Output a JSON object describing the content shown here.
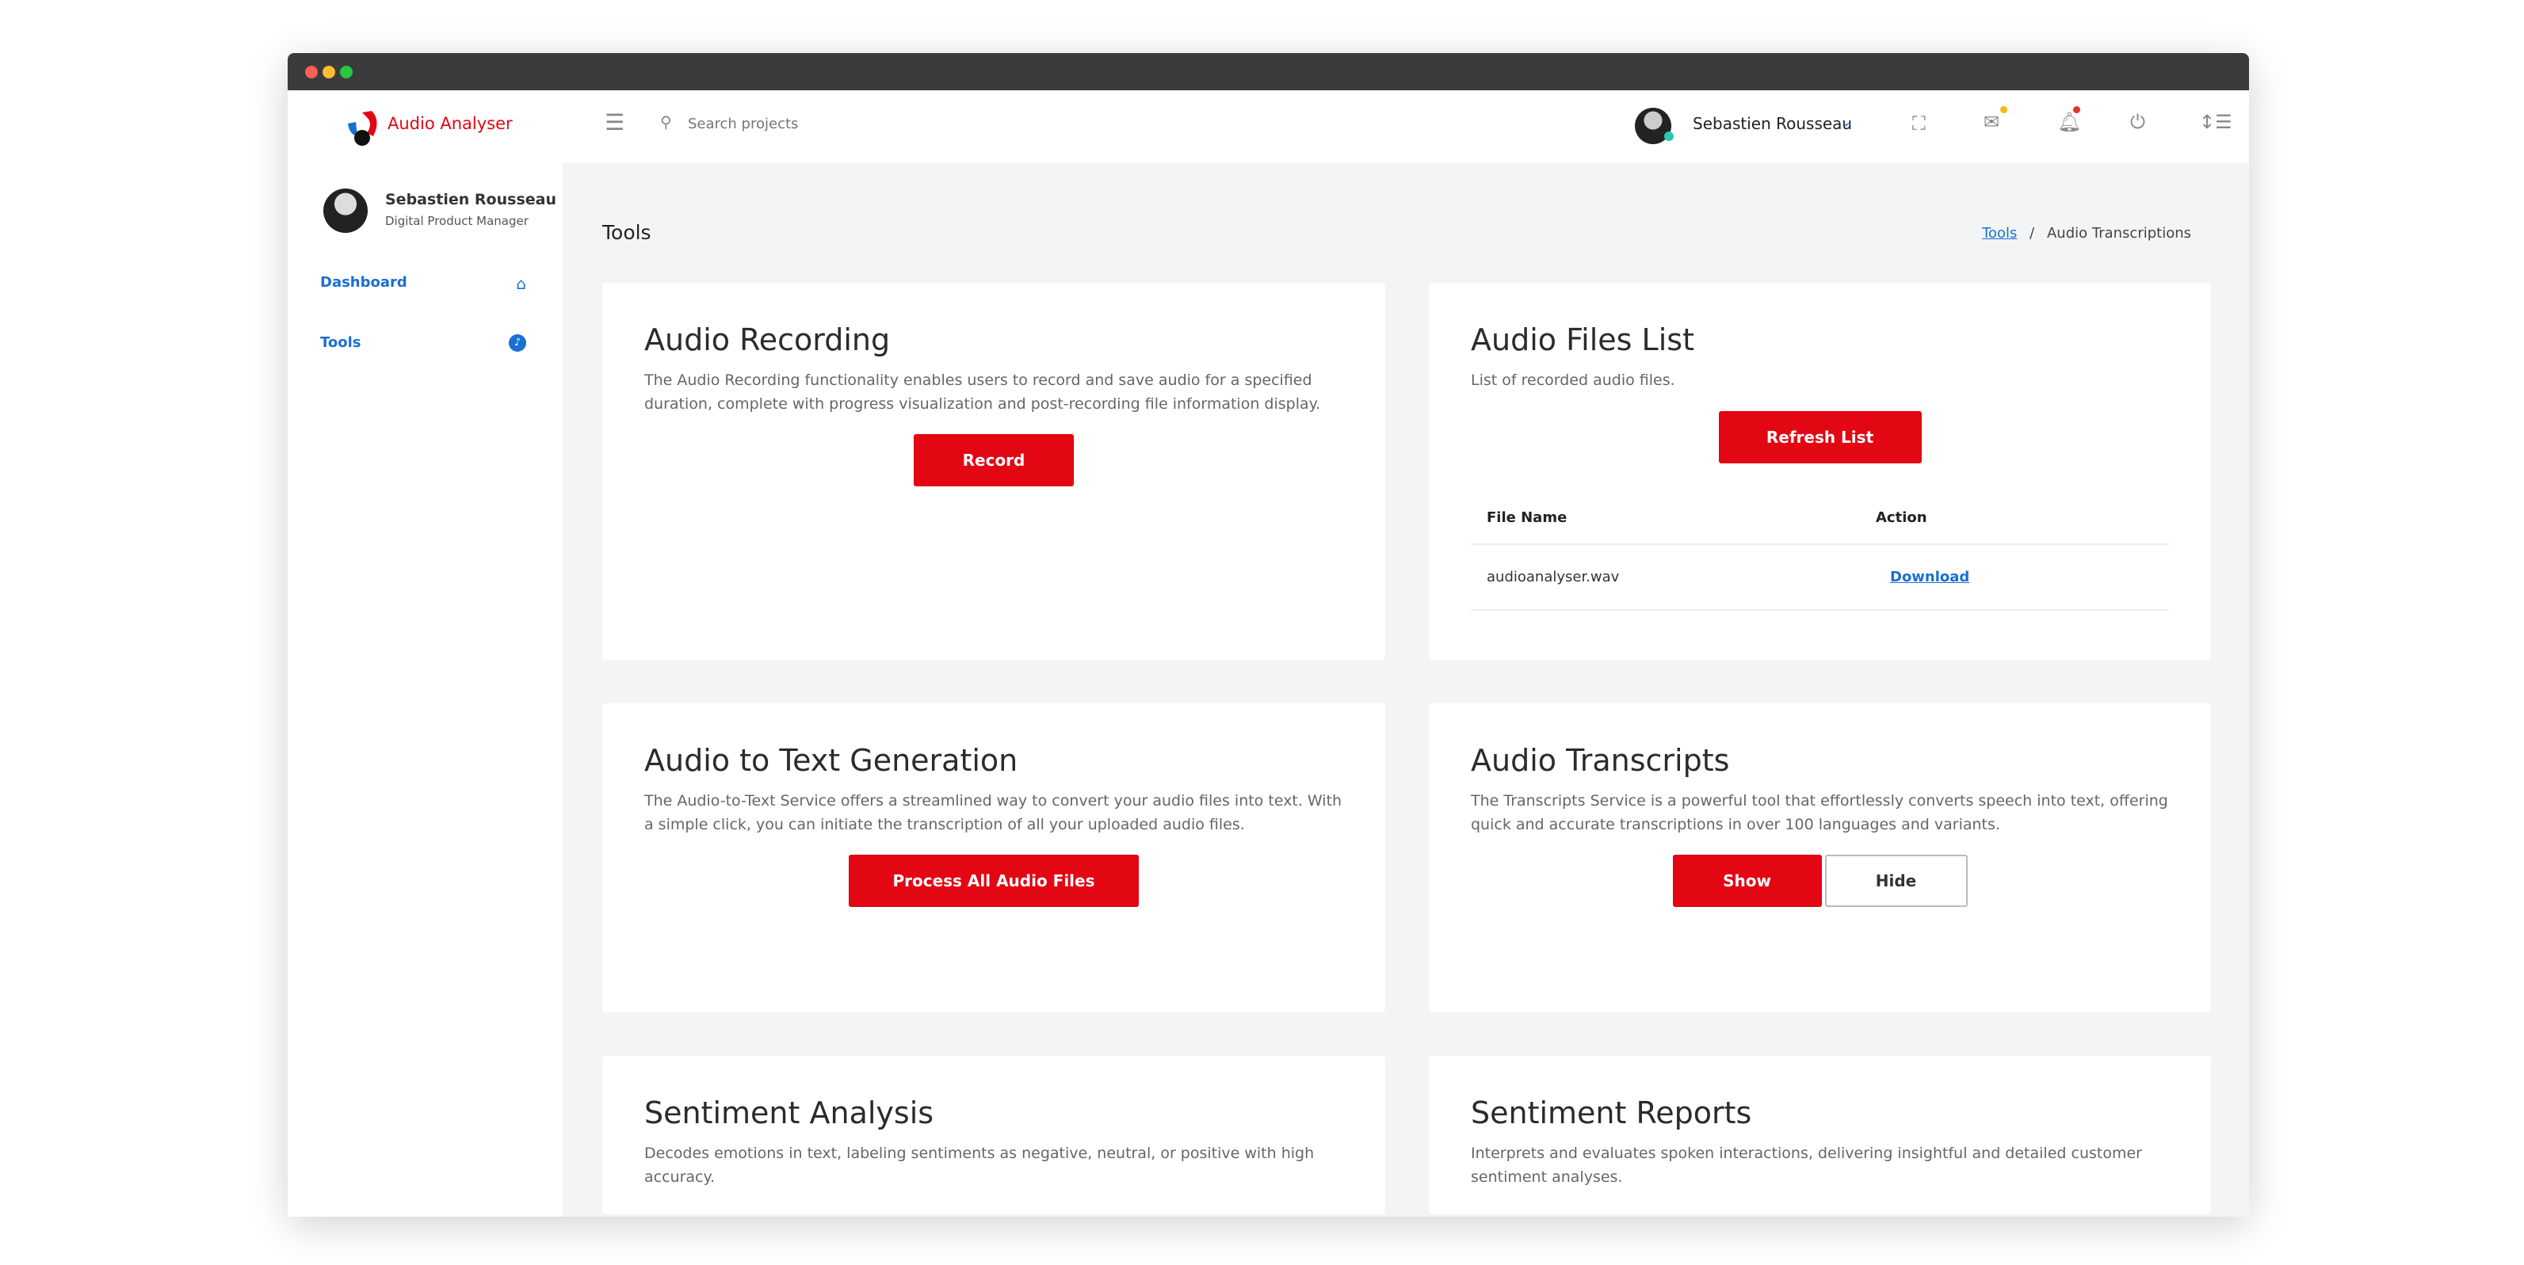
{
  "app": {
    "name": "Audio Analyser"
  },
  "header": {
    "search_placeholder": "Search projects",
    "user_name": "Sebastien Rousseau"
  },
  "sidebar": {
    "user_name": "Sebastien Rousseau",
    "user_role": "Digital Product Manager",
    "items": [
      {
        "label": "Dashboard"
      },
      {
        "label": "Tools"
      }
    ]
  },
  "page": {
    "title": "Tools",
    "breadcrumb": {
      "link": "Tools",
      "sep": "/",
      "current": "Audio Transcriptions"
    }
  },
  "cards": {
    "recording": {
      "title": "Audio Recording",
      "desc": "The Audio Recording functionality enables users to record and save audio for a specified duration, complete with progress visualization and post-recording file information display.",
      "button": "Record"
    },
    "files": {
      "title": "Audio Files List",
      "desc": "List of recorded audio files.",
      "button": "Refresh List",
      "columns": [
        "File Name",
        "Action"
      ],
      "rows": [
        {
          "file": "audioanalyser.wav",
          "action": "Download"
        }
      ]
    },
    "a2t": {
      "title": "Audio to Text Generation",
      "desc": "The Audio-to-Text Service offers a streamlined way to convert your audio files into text. With a simple click, you can initiate the transcription of all your uploaded audio files.",
      "button": "Process All Audio Files"
    },
    "transcripts": {
      "title": "Audio Transcripts",
      "desc": "The Transcripts Service is a powerful tool that effortlessly converts speech into text, offering quick and accurate transcriptions in over 100 languages and variants.",
      "show": "Show",
      "hide": "Hide"
    },
    "sentiment": {
      "title": "Sentiment Analysis",
      "desc": "Decodes emotions in text, labeling sentiments as negative, neutral, or positive with high accuracy."
    },
    "reports": {
      "title": "Sentiment Reports",
      "desc": "Interprets and evaluates spoken interactions, delivering insightful and detailed customer sentiment analyses."
    }
  },
  "colors": {
    "accent": "#e30613",
    "link": "#1a6fd1",
    "titlebar": "#3a3b3d"
  }
}
